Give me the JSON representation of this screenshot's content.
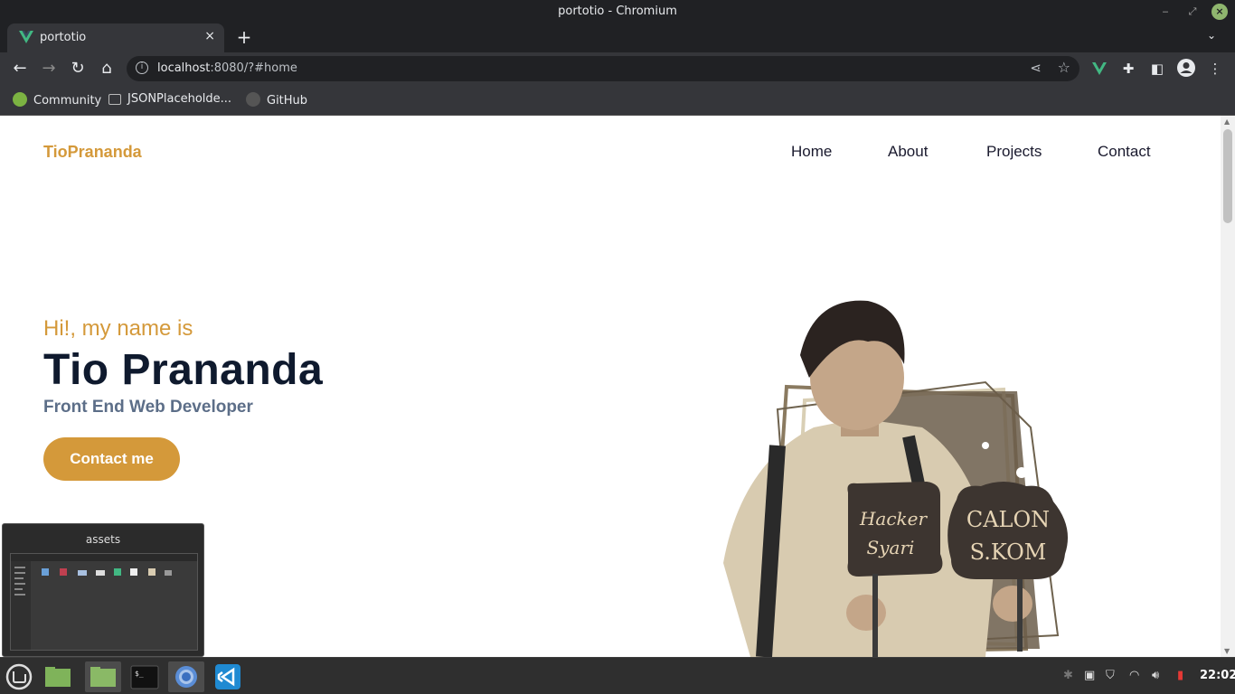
{
  "window": {
    "title": "portotio - Chromium"
  },
  "tabs": [
    {
      "label": "portotio",
      "close": "×"
    }
  ],
  "toolbar": {
    "url_host": "localhost",
    "url_rest": ":8080/?#home"
  },
  "bookmarks": [
    {
      "label": "Community",
      "icon": "mint-icon"
    },
    {
      "label": "JSONPlaceholde...",
      "icon": "json-placeholder-icon"
    },
    {
      "label": "GitHub",
      "icon": "github-icon"
    }
  ],
  "site": {
    "brand": "TioPrananda",
    "nav": [
      "Home",
      "About",
      "Projects",
      "Contact"
    ],
    "hero": {
      "greeting": "Hi!, my name is",
      "name": "Tio Prananda",
      "role": "Front End Web Developer",
      "cta": "Contact me"
    },
    "photo_signs": {
      "left": "Hacker Syari",
      "right": "CALON S.KOM"
    }
  },
  "preview": {
    "label": "assets"
  },
  "taskbar": {
    "clock": "22:02"
  },
  "colors": {
    "accent": "#d4993a",
    "heading": "#0f1a2e",
    "subheading": "#5c6e88",
    "chrome_dark": "#202124",
    "chrome_toolbar": "#35363a"
  }
}
